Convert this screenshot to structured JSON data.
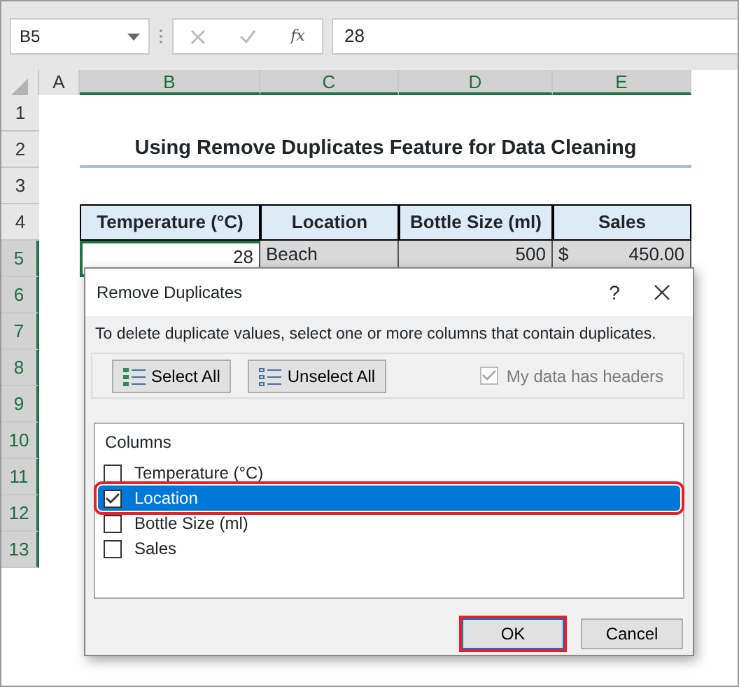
{
  "formula_bar": {
    "name_box": "B5",
    "function_label": "fx",
    "value": "28"
  },
  "column_headers": [
    {
      "label": "A",
      "selected": false
    },
    {
      "label": "B",
      "selected": true
    },
    {
      "label": "C",
      "selected": true
    },
    {
      "label": "D",
      "selected": true
    },
    {
      "label": "E",
      "selected": true
    }
  ],
  "row_headers": [
    {
      "label": "1",
      "selected": false
    },
    {
      "label": "2",
      "selected": false
    },
    {
      "label": "3",
      "selected": false
    },
    {
      "label": "4",
      "selected": false
    },
    {
      "label": "5",
      "selected": true
    },
    {
      "label": "6",
      "selected": true
    },
    {
      "label": "7",
      "selected": true
    },
    {
      "label": "8",
      "selected": true
    },
    {
      "label": "9",
      "selected": true
    },
    {
      "label": "10",
      "selected": true
    },
    {
      "label": "11",
      "selected": true
    },
    {
      "label": "12",
      "selected": true
    },
    {
      "label": "13",
      "selected": true
    }
  ],
  "sheet_title": "Using Remove Duplicates Feature for Data Cleaning",
  "table": {
    "columns": [
      "Temperature (°C)",
      "Location",
      "Bottle Size (ml)",
      "Sales"
    ],
    "rows": [
      {
        "temperature": "28",
        "location": "Beach",
        "bottle_size": "500",
        "currency": "$",
        "sales": "450.00"
      }
    ]
  },
  "dialog": {
    "title": "Remove Duplicates",
    "help": "?",
    "instruction": "To delete duplicate values, select one or more columns that contain duplicates.",
    "select_all": "Select All",
    "unselect_all": "Unselect All",
    "headers_option": {
      "label": "My data has headers",
      "checked": true,
      "disabled": true
    },
    "columns_label": "Columns",
    "columns": [
      {
        "label": "Temperature (°C)",
        "checked": false,
        "selected": false,
        "highlighted": false
      },
      {
        "label": "Location",
        "checked": true,
        "selected": true,
        "highlighted": true
      },
      {
        "label": "Bottle Size (ml)",
        "checked": false,
        "selected": false,
        "highlighted": false
      },
      {
        "label": "Sales",
        "checked": false,
        "selected": false,
        "highlighted": false
      }
    ],
    "buttons": [
      {
        "label": "OK",
        "kind": "default",
        "highlighted": true
      },
      {
        "label": "Cancel",
        "kind": "normal",
        "highlighted": false
      }
    ]
  }
}
